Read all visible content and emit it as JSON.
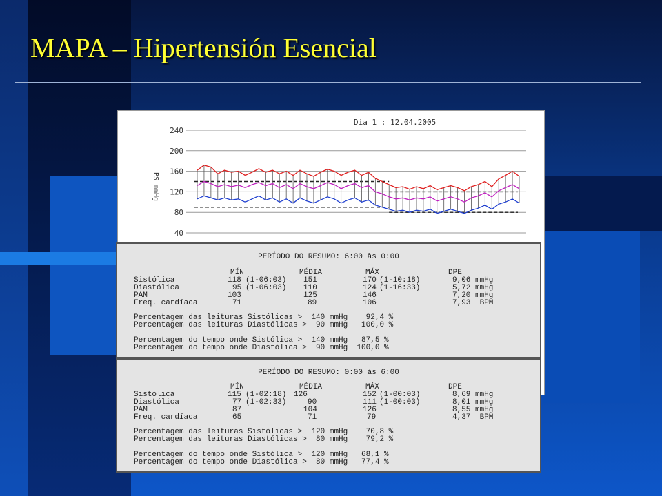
{
  "slide": {
    "title": "MAPA – Hipertensión Esencial"
  },
  "chart_data": {
    "type": "line",
    "title": "Dia 1 : 12.04.2005",
    "ylabel": "PS mmHg",
    "y_ticks": [
      40,
      80,
      120,
      160,
      200,
      240
    ],
    "ylim": [
      40,
      240
    ],
    "reference_lines": [
      140,
      90
    ],
    "reference_lines_late": [
      120,
      80
    ],
    "x": [
      0,
      1,
      2,
      3,
      4,
      5,
      6,
      7,
      8,
      9,
      10,
      11,
      12,
      13,
      14,
      15,
      16,
      17,
      18,
      19,
      20,
      21,
      22,
      23,
      24,
      25,
      26,
      27,
      28,
      29,
      30,
      31,
      32,
      33,
      34,
      35,
      36,
      37,
      38,
      39,
      40,
      41,
      42,
      43,
      44,
      45,
      46,
      47
    ],
    "series": [
      {
        "color": "#e02020",
        "values": [
          162,
          172,
          168,
          155,
          162,
          158,
          160,
          152,
          158,
          165,
          158,
          162,
          155,
          160,
          152,
          162,
          155,
          150,
          158,
          164,
          160,
          152,
          158,
          162,
          152,
          158,
          146,
          140,
          134,
          128,
          130,
          125,
          130,
          126,
          132,
          124,
          128,
          132,
          128,
          122,
          130,
          134,
          140,
          130,
          145,
          152,
          160,
          150
        ]
      },
      {
        "color": "#c020c0",
        "values": [
          132,
          140,
          136,
          130,
          134,
          130,
          133,
          128,
          134,
          138,
          132,
          136,
          128,
          134,
          126,
          136,
          130,
          126,
          132,
          138,
          134,
          126,
          132,
          136,
          128,
          132,
          120,
          116,
          110,
          106,
          108,
          104,
          108,
          106,
          110,
          102,
          106,
          110,
          106,
          100,
          108,
          112,
          118,
          110,
          122,
          128,
          134,
          126
        ]
      },
      {
        "color": "#2040d0",
        "values": [
          106,
          112,
          108,
          104,
          108,
          104,
          106,
          100,
          106,
          112,
          104,
          108,
          100,
          106,
          98,
          108,
          102,
          98,
          104,
          110,
          106,
          98,
          104,
          108,
          100,
          104,
          94,
          90,
          86,
          82,
          84,
          80,
          84,
          82,
          86,
          78,
          82,
          86,
          82,
          78,
          84,
          88,
          94,
          86,
          96,
          100,
          106,
          98
        ]
      }
    ]
  },
  "summaries": [
    {
      "title": "PERÍODO DO RESUMO: 6:00 às 0:00",
      "headers": {
        "min": "MÍN",
        "media": "MÉDIA",
        "max": "MÁX",
        "dpe": "DPE"
      },
      "rows": [
        {
          "label": "Sistólica",
          "min": "118",
          "min_time": "(1-06:03)",
          "media": "151",
          "max": "170",
          "max_time": "(1-10:18)",
          "dpe": "9,06 mmHg"
        },
        {
          "label": "Diastólica",
          "min": "95",
          "min_time": "(1-06:03)",
          "media": "110",
          "max": "124",
          "max_time": "(1-16:33)",
          "dpe": "5,72 mmHg"
        },
        {
          "label": "PAM",
          "min": "103",
          "min_time": "",
          "media": "125",
          "max": "146",
          "max_time": "",
          "dpe": "7,20 mmHg"
        },
        {
          "label": "Freq. cardíaca",
          "min": "71",
          "min_time": "",
          "media": "89",
          "max": "106",
          "max_time": "",
          "dpe": "7,93  BPM"
        }
      ],
      "lines": [
        "Percentagem das leituras Sistólicas >  140 mmHg    92,4 %",
        "Percentagem das leituras Diastólicas >  90 mmHg   100,0 %",
        "Percentagem do tempo onde Sistólica >  140 mmHg   87,5 %",
        "Percentagem do tempo onde Diastólica >  90 mmHg  100,0 %"
      ]
    },
    {
      "title": "PERÍODO DO RESUMO: 0:00 às 6:00",
      "headers": {
        "min": "MÍN",
        "media": "MÉDIA",
        "max": "MÁX",
        "dpe": "DPE"
      },
      "rows": [
        {
          "label": "Sistólica",
          "min": "115",
          "min_time": "(1-02:18)",
          "media": "126",
          "max": "152",
          "max_time": "(1-00:03)",
          "dpe": "8,69 mmHg"
        },
        {
          "label": "Diastólica",
          "min": "77",
          "min_time": "(1-02:33)",
          "media": "90",
          "max": "111",
          "max_time": "(1-00:03)",
          "dpe": "8,01 mmHg"
        },
        {
          "label": "PAM",
          "min": "87",
          "min_time": "",
          "media": "104",
          "max": "126",
          "max_time": "",
          "dpe": "8,55 mmHg"
        },
        {
          "label": "Freq. cardíaca",
          "min": "65",
          "min_time": "",
          "media": "71",
          "max": "79",
          "max_time": "",
          "dpe": "4,37  BPM"
        }
      ],
      "lines": [
        "Percentagem das leituras Sistólicas >  120 mmHg    70,8 %",
        "Percentagem das leituras Diastólicas >  80 mmHg    79,2 %",
        "Percentagem do tempo onde Sistólica >  120 mmHg   68,1 %",
        "Percentagem do tempo onde Diastólica >  80 mmHg   77,4 %"
      ]
    }
  ]
}
